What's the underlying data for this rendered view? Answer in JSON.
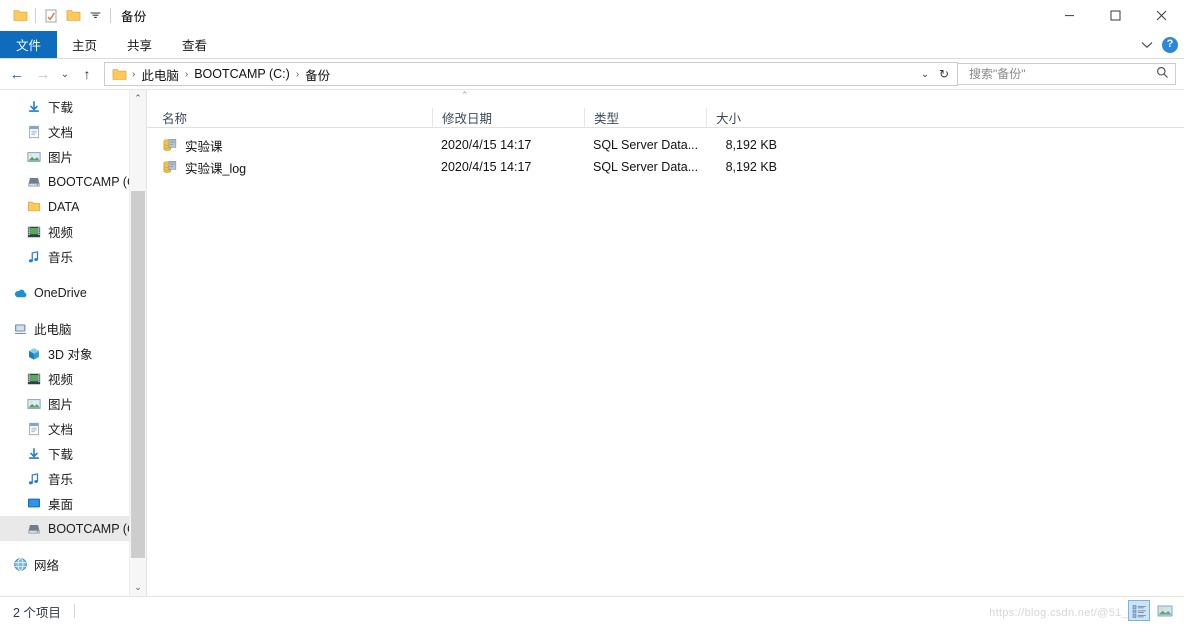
{
  "window": {
    "title": "备份",
    "quick_access": [
      {
        "name": "folder-icon",
        "label": "文件夹"
      },
      {
        "name": "properties-icon",
        "label": "属性"
      },
      {
        "name": "new-folder-icon",
        "label": "新建文件夹"
      },
      {
        "name": "chevron-down-icon",
        "label": "自定义快速访问工具栏"
      }
    ],
    "controls": {
      "minimize": "—",
      "maximize": "▢",
      "close": "✕"
    }
  },
  "ribbon": {
    "tabs": [
      {
        "label": "文件",
        "active": true
      },
      {
        "label": "主页",
        "active": false
      },
      {
        "label": "共享",
        "active": false
      },
      {
        "label": "查看",
        "active": false
      }
    ],
    "expand_icon": "chevron-down-icon",
    "help_label": "?"
  },
  "addressbar": {
    "back_icon": "←",
    "forward_icon": "→",
    "recent_icon": "⌄",
    "up_icon": "↑",
    "breadcrumbs": [
      "此电脑",
      "BOOTCAMP (C:)",
      "备份"
    ],
    "separator": "›",
    "history_icon": "⌄",
    "refresh_icon": "↻"
  },
  "search": {
    "placeholder": "搜索\"备份\"",
    "value": "",
    "icon": "search-icon"
  },
  "sidebar": {
    "groups": [
      {
        "items": [
          {
            "label": "下载",
            "icon": "download-icon",
            "level": 1,
            "pinned": true,
            "selected": false
          },
          {
            "label": "文档",
            "icon": "document-icon",
            "level": 1,
            "pinned": true,
            "selected": false
          },
          {
            "label": "图片",
            "icon": "pictures-icon",
            "level": 1,
            "pinned": true,
            "selected": false
          },
          {
            "label": "BOOTCAMP (C:",
            "icon": "drive-icon",
            "level": 1,
            "pinned": false,
            "selected": false
          },
          {
            "label": "DATA",
            "icon": "folder-icon",
            "level": 1,
            "pinned": false,
            "selected": false
          },
          {
            "label": "视频",
            "icon": "video-icon",
            "level": 1,
            "pinned": false,
            "selected": false
          },
          {
            "label": "音乐",
            "icon": "music-icon",
            "level": 1,
            "pinned": false,
            "selected": false
          }
        ]
      },
      {
        "items": [
          {
            "label": "OneDrive",
            "icon": "onedrive-icon",
            "level": 0,
            "pinned": false,
            "selected": false
          }
        ]
      },
      {
        "items": [
          {
            "label": "此电脑",
            "icon": "computer-icon",
            "level": 0,
            "pinned": false,
            "selected": false
          },
          {
            "label": "3D 对象",
            "icon": "3d-objects-icon",
            "level": 1,
            "pinned": false,
            "selected": false
          },
          {
            "label": "视频",
            "icon": "video-icon",
            "level": 1,
            "pinned": false,
            "selected": false
          },
          {
            "label": "图片",
            "icon": "pictures-icon",
            "level": 1,
            "pinned": false,
            "selected": false
          },
          {
            "label": "文档",
            "icon": "document-icon",
            "level": 1,
            "pinned": false,
            "selected": false
          },
          {
            "label": "下载",
            "icon": "download-icon",
            "level": 1,
            "pinned": false,
            "selected": false
          },
          {
            "label": "音乐",
            "icon": "music-icon",
            "level": 1,
            "pinned": false,
            "selected": false
          },
          {
            "label": "桌面",
            "icon": "desktop-icon",
            "level": 1,
            "pinned": false,
            "selected": false
          },
          {
            "label": "BOOTCAMP (C:",
            "icon": "drive-icon",
            "level": 1,
            "pinned": false,
            "selected": true
          }
        ]
      },
      {
        "items": [
          {
            "label": "网络",
            "icon": "network-icon",
            "level": 0,
            "pinned": false,
            "selected": false
          }
        ]
      }
    ],
    "scrollbar": {
      "up": "⌃",
      "down": "⌄"
    }
  },
  "filelist": {
    "columns": [
      {
        "label": "名称",
        "key": "name"
      },
      {
        "label": "修改日期",
        "key": "date"
      },
      {
        "label": "类型",
        "key": "type"
      },
      {
        "label": "大小",
        "key": "size"
      }
    ],
    "sort_indicator": "⌃",
    "rows": [
      {
        "name": "实验课",
        "date": "2020/4/15 14:17",
        "type": "SQL Server Data...",
        "size": "8,192 KB",
        "icon": "sql-database-file-icon"
      },
      {
        "name": "实验课_log",
        "date": "2020/4/15 14:17",
        "type": "SQL Server Data...",
        "size": "8,192 KB",
        "icon": "sql-database-file-icon"
      }
    ]
  },
  "statusbar": {
    "item_count": "2 个项目",
    "views": [
      {
        "name": "details-view-button",
        "active": true
      },
      {
        "name": "large-icons-view-button",
        "active": false
      }
    ],
    "watermark": "https://blog.csdn.net/@51_"
  },
  "colors": {
    "accent": "#0f6cbd",
    "selection": "#e9e9e9",
    "header_text": "#3b4a5a",
    "help_blue": "#2b88d8"
  }
}
